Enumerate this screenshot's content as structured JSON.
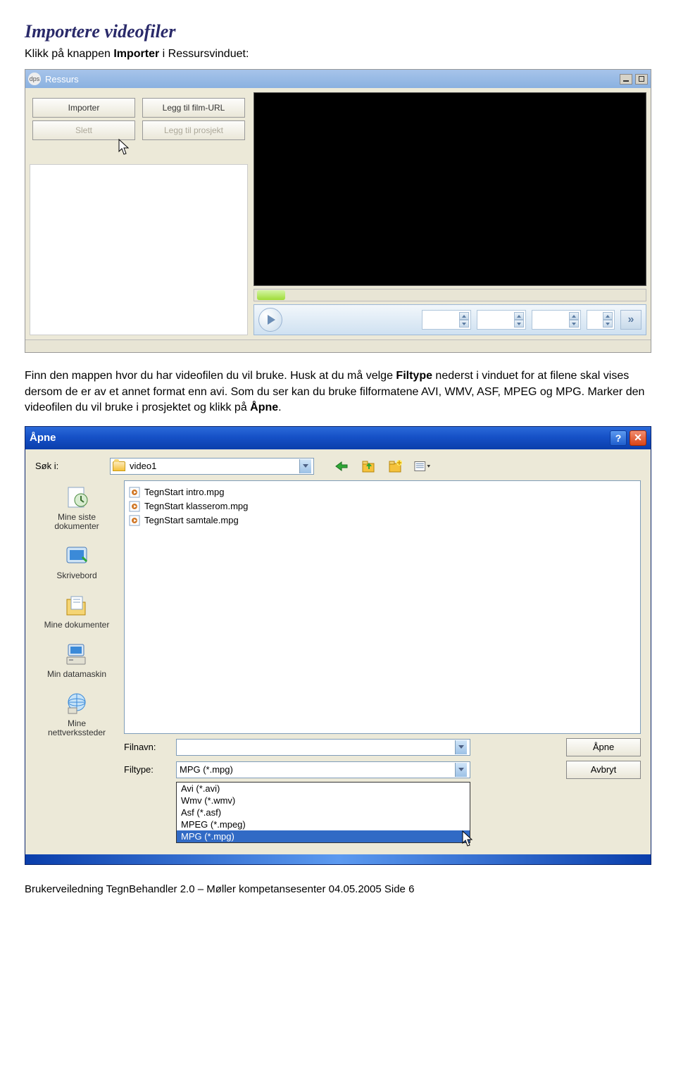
{
  "heading": "Importere videofiler",
  "intro_text_before": "Klikk på knappen ",
  "intro_text_bold": "Importer",
  "intro_text_after": " i Ressursvinduet:",
  "ressurs": {
    "title": "Ressurs",
    "buttons": {
      "importer": "Importer",
      "legg_til_film": "Legg til film-URL",
      "slett": "Slett",
      "legg_til_prosjekt": "Legg til prosjekt"
    }
  },
  "para2": {
    "p1a": "Finn den mappen hvor du har videofilen du vil bruke. Husk at du må velge ",
    "p1b": "Filtype",
    "p1c": " nederst i vinduet for at filene skal vises dersom de er av et annet format enn avi. Som du ser kan du bruke filformatene AVI, WMV, ASF, MPEG og MPG. Marker den videofilen du vil bruke i prosjektet og klikk på ",
    "p1d": "Åpne",
    "p1e": "."
  },
  "open_dialog": {
    "title": "Åpne",
    "sok_label": "Søk i:",
    "folder": "video1",
    "places": {
      "recent": "Mine siste dokumenter",
      "desktop": "Skrivebord",
      "mydocs": "Mine dokumenter",
      "mycomp": "Min datamaskin",
      "network": "Mine nettverkssteder"
    },
    "files": [
      "TegnStart intro.mpg",
      "TegnStart klasserom.mpg",
      "TegnStart samtale.mpg"
    ],
    "filnavn_label": "Filnavn:",
    "filnavn_value": "",
    "filtype_label": "Filtype:",
    "filtype_value": "MPG (*.mpg)",
    "filter_options": [
      "Avi (*.avi)",
      "Wmv (*.wmv)",
      "Asf (*.asf)",
      "MPEG (*.mpeg)",
      "MPG (*.mpg)"
    ],
    "filter_selected_index": 4,
    "apne": "Åpne",
    "avbryt": "Avbryt"
  },
  "footer": "Brukerveiledning TegnBehandler 2.0 – Møller kompetansesenter 04.05.2005   Side 6"
}
